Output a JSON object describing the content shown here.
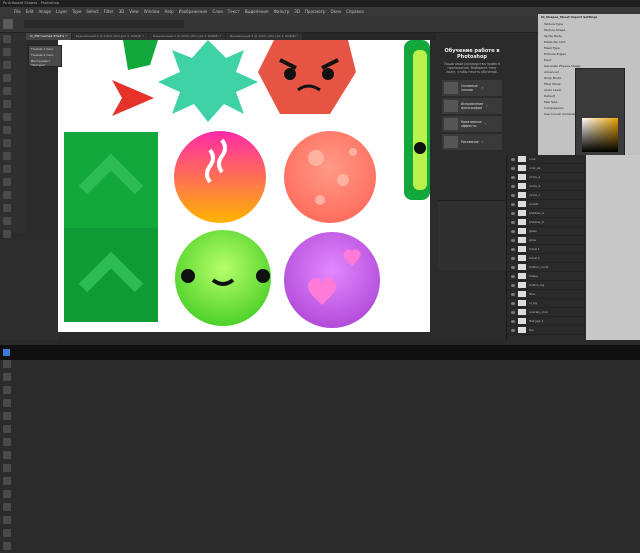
{
  "window": {
    "title": "Ps Artboard Shapes - Photoshop"
  },
  "menu": [
    "File",
    "Edit",
    "Image",
    "Layer",
    "Type",
    "Select",
    "Filter",
    "3D",
    "View",
    "Window",
    "Help",
    "Изображение",
    "Слои",
    "Текст",
    "Выделение",
    "Фильтр",
    "3D",
    "Просмотр",
    "Окно",
    "Справка"
  ],
  "tabs": [
    {
      "label": "Ui_PSD Game4 #3x4% *",
      "active": true
    },
    {
      "label": "Безымянный-1 @ 100% (Фигура 3, RGB/8) *",
      "active": false
    },
    {
      "label": "Безымянный-2 @ 100% (Фигура 1, RGB/8) *",
      "active": false
    },
    {
      "label": "Безымянный-3 @ 100% (Фигура 1, RGB/8) *",
      "active": false
    }
  ],
  "popup": {
    "items": [
      "Тонкий 1 пикс",
      "Тонкий 2 пикс",
      "Инструмент \"Фигура\""
    ]
  },
  "learn": {
    "title": "Обучение работе в Photoshop",
    "subtitle": "Пошаговые руководства прямо в приложении. Выберите тему ниже, чтобы начать обучение.",
    "lessons": [
      "Основные знания",
      "Исправление фотографии",
      "Креативные эффекты",
      "Рисование"
    ]
  },
  "layers": [
    "cruz",
    "cruz_sq",
    "circle_a",
    "circle_b",
    "circle_c",
    "rocket",
    "shadow_a",
    "shadow_b",
    "glass",
    "glow",
    "Слой 1",
    "Слой 2",
    "button_circle",
    "shape",
    "button_bg",
    "Фон",
    "ui_bg",
    "overlay_icon",
    "Фигура 1",
    "tile"
  ],
  "unity": {
    "title": "UI_Shapes_Sheet Import Settings",
    "rows": [
      "Texture Type",
      "Texture Shape",
      "Sprite Mode",
      "Pixels Per Unit",
      "Mesh Type",
      "Extrude Edges",
      "Pivot",
      "Generate Physics Shape",
      "Advanced",
      "Wrap Mode",
      "Filter Mode",
      "Aniso Level",
      "Default",
      "Max Size",
      "Compression",
      "Use Crunch Compression"
    ]
  },
  "colors": {
    "green": "#12a83b",
    "coral": "#e65443",
    "teal": "#3fd2a7",
    "red": "#e5332a",
    "pink": "#ee6ec8"
  }
}
